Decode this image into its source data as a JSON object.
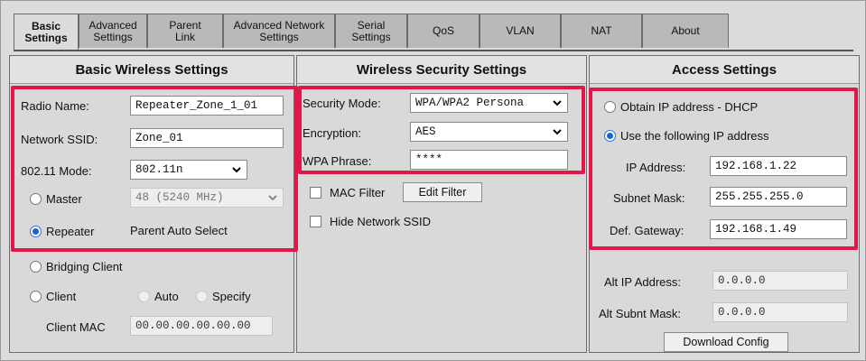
{
  "tabs": [
    {
      "label": "Basic\nSettings"
    },
    {
      "label": "Advanced\nSettings"
    },
    {
      "label": "Parent\nLink"
    },
    {
      "label": "Advanced Network\nSettings"
    },
    {
      "label": "Serial\nSettings"
    },
    {
      "label": "QoS"
    },
    {
      "label": "VLAN"
    },
    {
      "label": "NAT"
    },
    {
      "label": "About"
    }
  ],
  "basic": {
    "title": "Basic Wireless Settings",
    "radio_name_label": "Radio Name:",
    "radio_name": "Repeater_Zone_1_01",
    "ssid_label": "Network SSID:",
    "ssid": "Zone_01",
    "mode_label": "802.11 Mode:",
    "mode": "802.11n",
    "master_label": "Master",
    "master_channel": "48 (5240 MHz)",
    "repeater_label": "Repeater",
    "parent_auto": "Parent Auto Select",
    "bridging_label": "Bridging Client",
    "client_label": "Client",
    "auto_label": "Auto",
    "specify_label": "Specify",
    "client_mac_label": "Client MAC",
    "client_mac": "00.00.00.00.00.00"
  },
  "security": {
    "title": "Wireless Security Settings",
    "mode_label": "Security Mode:",
    "mode": "WPA/WPA2 Persona",
    "enc_label": "Encryption:",
    "enc": "AES",
    "phrase_label": "WPA Phrase:",
    "phrase": "****",
    "mac_filter_label": "MAC Filter",
    "edit_filter": "Edit Filter",
    "hide_ssid_label": "Hide Network SSID"
  },
  "access": {
    "title": "Access Settings",
    "dhcp_label": "Obtain IP address - DHCP",
    "static_label": "Use the following IP address",
    "ip_label": "IP Address:",
    "ip": "192.168.1.22",
    "mask_label": "Subnet Mask:",
    "mask": "255.255.255.0",
    "gw_label": "Def. Gateway:",
    "gw": "192.168.1.49",
    "alt_ip_label": "Alt IP Address:",
    "alt_ip": "0.0.0.0",
    "alt_mask_label": "Alt Subnt Mask:",
    "alt_mask": "0.0.0.0",
    "download": "Download Config"
  },
  "colors": {
    "highlight": "#e0184a",
    "radio_selected": "#1a64d8"
  }
}
